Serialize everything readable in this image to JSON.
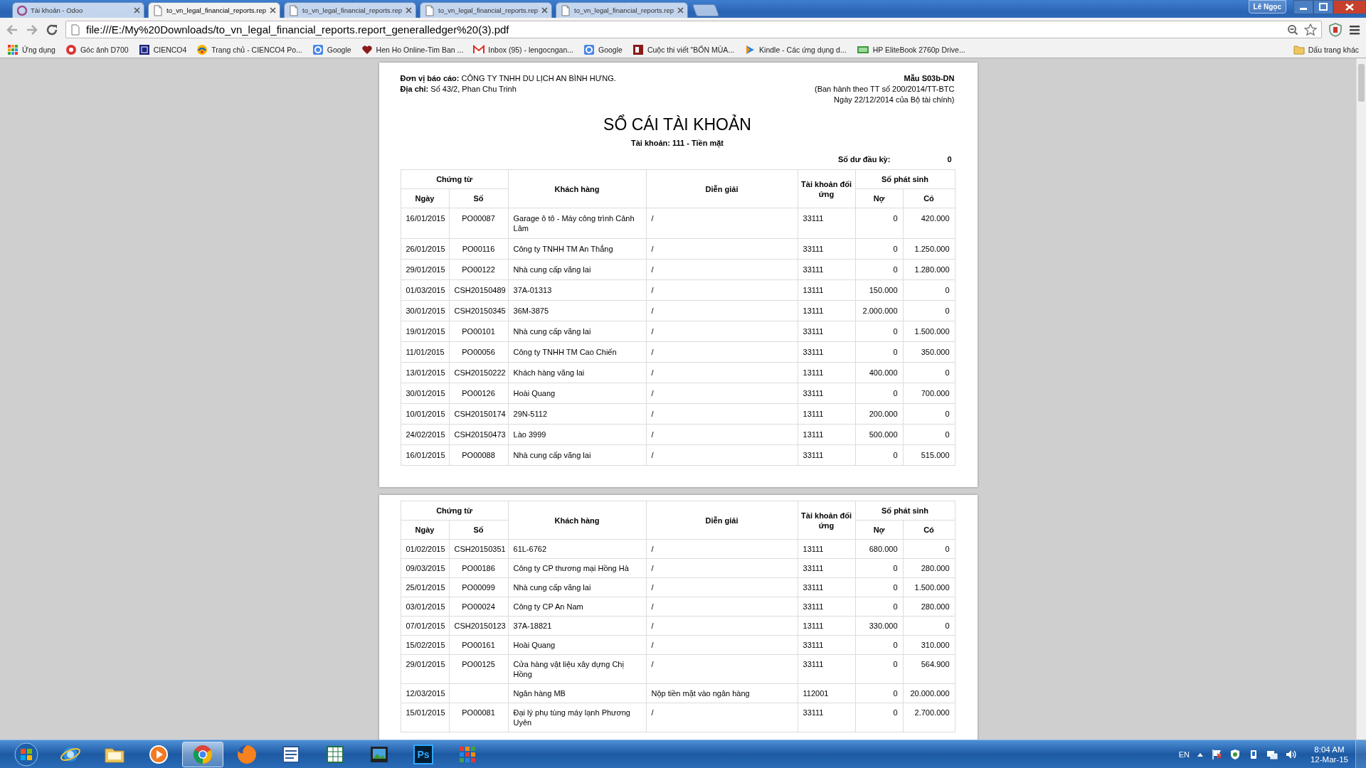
{
  "browser": {
    "tabs": [
      {
        "kind": "odoo",
        "title": "Tài khoản - Odoo",
        "selected": false
      },
      {
        "kind": "document",
        "title": "to_vn_legal_financial_reports.rep",
        "selected": true
      },
      {
        "kind": "document",
        "title": "to_vn_legal_financial_reports.rep",
        "selected": false
      },
      {
        "kind": "document",
        "title": "to_vn_legal_financial_reports.rep",
        "selected": false
      },
      {
        "kind": "document",
        "title": "to_vn_legal_financial_reports.rep",
        "selected": false
      }
    ],
    "profile": "Lê Ngọc",
    "address": "file:///E:/My%20Downloads/to_vn_legal_financial_reports.report_generalledger%20(3).pdf",
    "bookmarks": [
      {
        "kind": "apps",
        "label": "Ứng dụng"
      },
      {
        "kind": "camera",
        "label": "Góc ảnh D700"
      },
      {
        "kind": "square",
        "label": "CIENCO4"
      },
      {
        "kind": "swirl",
        "label": "Trang chủ - CIENCO4 Po..."
      },
      {
        "kind": "google",
        "label": "Google"
      },
      {
        "kind": "heart",
        "label": "Hen Ho Online-Tim Ban ..."
      },
      {
        "kind": "mail",
        "label": "Inbox (95) - lengocngan..."
      },
      {
        "kind": "google",
        "label": "Google"
      },
      {
        "kind": "book",
        "label": "Cuộc thi viết \"BỐN MÙA..."
      },
      {
        "kind": "play",
        "label": "Kindle - Các ứng dụng d..."
      },
      {
        "kind": "card",
        "label": "HP EliteBook 2760p Drive..."
      }
    ],
    "other_bookmarks": "Dấu trang khác"
  },
  "pages": [
    {
      "heading": {
        "unit": "**Đơn vị báo cáo:** CÔNG TY TNHH DU LỊCH AN BÌNH HƯNG.",
        "address": "**Địa chỉ:** Số 43/2, Phan Chu Trinh",
        "form": "Mẫu S03b-DN",
        "form_notes": [
          "(Ban hành theo TT số 200/2014/TT-BTC",
          "Ngày 22/12/2014 của Bộ tài chính)"
        ],
        "title": "SỔ CÁI TÀI KHOẢN",
        "account": "Tài khoản: 111 - Tiền mặt",
        "opening_label": "Số dư đầu kỳ:",
        "opening_value": "0"
      },
      "table_header": {
        "voucher": "Chứng từ",
        "date": "Ngày",
        "number": "Số",
        "customer": "Khách hàng",
        "description": "Diễn giải",
        "contra": "Tài khoản đối ứng",
        "amount": "Số phát sinh",
        "debit": "Nợ",
        "credit": "Có"
      },
      "rows": [
        {
          "date": "16/01/2015",
          "number": "PO00087",
          "customer": "Garage ô tô - Máy công trình Cảnh Lâm",
          "description": "/",
          "contra": "33111",
          "debit": "0",
          "credit": "420.000"
        },
        {
          "date": "26/01/2015",
          "number": "PO00116",
          "customer": "Công ty TNHH TM An Thắng",
          "description": "/",
          "contra": "33111",
          "debit": "0",
          "credit": "1.250.000"
        },
        {
          "date": "29/01/2015",
          "number": "PO00122",
          "customer": "Nhà cung cấp vãng lai",
          "description": "/",
          "contra": "33111",
          "debit": "0",
          "credit": "1.280.000"
        },
        {
          "date": "01/03/2015",
          "number": "CSH20150489",
          "customer": "37A-01313",
          "description": "/",
          "contra": "13111",
          "debit": "150.000",
          "credit": "0"
        },
        {
          "date": "30/01/2015",
          "number": "CSH20150345",
          "customer": "36M-3875",
          "description": "/",
          "contra": "13111",
          "debit": "2.000.000",
          "credit": "0"
        },
        {
          "date": "19/01/2015",
          "number": "PO00101",
          "customer": "Nhà cung cấp vãng lai",
          "description": "/",
          "contra": "33111",
          "debit": "0",
          "credit": "1.500.000"
        },
        {
          "date": "11/01/2015",
          "number": "PO00056",
          "customer": "Công ty TNHH TM Cao Chiến",
          "description": "/",
          "contra": "33111",
          "debit": "0",
          "credit": "350.000"
        },
        {
          "date": "13/01/2015",
          "number": "CSH20150222",
          "customer": "Khách hàng vãng lai",
          "description": "/",
          "contra": "13111",
          "debit": "400.000",
          "credit": "0"
        },
        {
          "date": "30/01/2015",
          "number": "PO00126",
          "customer": "Hoài Quang",
          "description": "/",
          "contra": "33111",
          "debit": "0",
          "credit": "700.000"
        },
        {
          "date": "10/01/2015",
          "number": "CSH20150174",
          "customer": "29N-5112",
          "description": "/",
          "contra": "13111",
          "debit": "200.000",
          "credit": "0"
        },
        {
          "date": "24/02/2015",
          "number": "CSH20150473",
          "customer": "Lào 3999",
          "description": "/",
          "contra": "13111",
          "debit": "500.000",
          "credit": "0"
        },
        {
          "date": "16/01/2015",
          "number": "PO00088",
          "customer": "Nhà cung cấp vãng lai",
          "description": "/",
          "contra": "33111",
          "debit": "0",
          "credit": "515.000"
        }
      ]
    },
    {
      "table_header": {
        "voucher": "Chứng từ",
        "date": "Ngày",
        "number": "Số",
        "customer": "Khách hàng",
        "description": "Diễn giải",
        "contra": "Tài khoản đối ứng",
        "amount": "Số phát sinh",
        "debit": "Nợ",
        "credit": "Có"
      },
      "rows": [
        {
          "date": "01/02/2015",
          "number": "CSH20150351",
          "customer": "61L-6762",
          "description": "/",
          "contra": "13111",
          "debit": "680.000",
          "credit": "0"
        },
        {
          "date": "09/03/2015",
          "number": "PO00186",
          "customer": "Công ty CP thương mại Hồng Hà",
          "description": "/",
          "contra": "33111",
          "debit": "0",
          "credit": "280.000"
        },
        {
          "date": "25/01/2015",
          "number": "PO00099",
          "customer": "Nhà cung cấp vãng lai",
          "description": "/",
          "contra": "33111",
          "debit": "0",
          "credit": "1.500.000"
        },
        {
          "date": "03/01/2015",
          "number": "PO00024",
          "customer": "Công ty CP An Nam",
          "description": "/",
          "contra": "33111",
          "debit": "0",
          "credit": "280.000"
        },
        {
          "date": "07/01/2015",
          "number": "CSH20150123",
          "customer": "37A-18821",
          "description": "/",
          "contra": "13111",
          "debit": "330.000",
          "credit": "0"
        },
        {
          "date": "15/02/2015",
          "number": "PO00161",
          "customer": "Hoài Quang",
          "description": "/",
          "contra": "33111",
          "debit": "0",
          "credit": "310.000"
        },
        {
          "date": "29/01/2015",
          "number": "PO00125",
          "customer": "Cửa hàng vật liệu xây dựng Chị Hồng",
          "description": "/",
          "contra": "33111",
          "debit": "0",
          "credit": "564.900"
        },
        {
          "date": "12/03/2015",
          "customer": "Ngân hàng MB",
          "description": "Nộp tiền mặt vào ngân hàng",
          "contra": "112001",
          "debit": "0",
          "credit": "20.000.000"
        },
        {
          "date": "15/01/2015",
          "number": "PO00081",
          "customer": "Đại lý phụ tùng máy lạnh Phương Uyên",
          "description": "/",
          "contra": "33111",
          "debit": "0",
          "credit": "2.700.000"
        }
      ]
    }
  ],
  "taskbar": {
    "apps": [
      {
        "kind": "start",
        "selected": false
      },
      {
        "kind": "ie",
        "selected": false
      },
      {
        "kind": "explorer",
        "selected": false
      },
      {
        "kind": "media",
        "selected": false
      },
      {
        "kind": "chrome",
        "selected": true
      },
      {
        "kind": "firefox",
        "selected": false
      },
      {
        "kind": "word",
        "selected": false
      },
      {
        "kind": "excel",
        "selected": false
      },
      {
        "kind": "viewer",
        "selected": false
      },
      {
        "kind": "photoshop",
        "label": "Ps",
        "selected": false
      },
      {
        "kind": "grid",
        "selected": false
      }
    ],
    "language": "EN",
    "time": "8:04 AM",
    "date": "12-Mar-15"
  }
}
